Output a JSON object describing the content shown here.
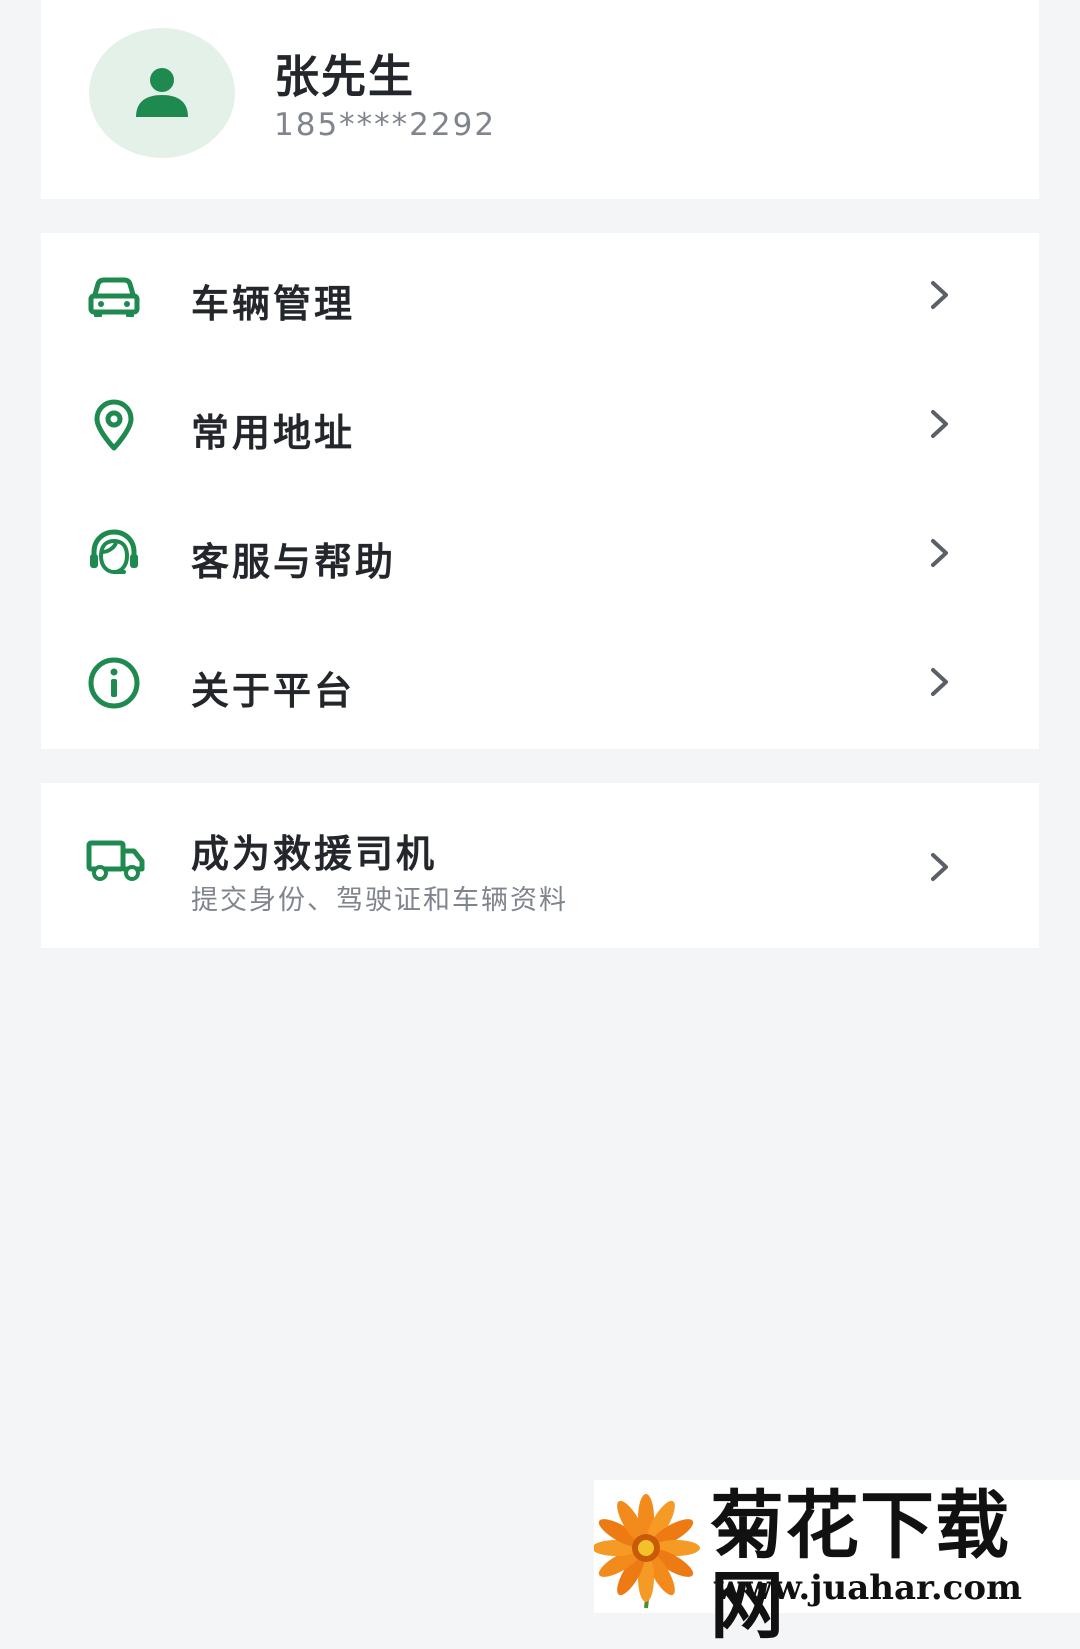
{
  "profile": {
    "name": "张先生",
    "phone": "185****2292",
    "avatar_icon": "user-avatar-icon"
  },
  "menu": {
    "items": [
      {
        "label": "车辆管理",
        "icon": "car-icon"
      },
      {
        "label": "常用地址",
        "icon": "location-pin-icon"
      },
      {
        "label": "客服与帮助",
        "icon": "customer-service-icon"
      },
      {
        "label": "关于平台",
        "icon": "info-icon"
      }
    ]
  },
  "driver": {
    "title": "成为救援司机",
    "subtitle": "提交身份、驾驶证和车辆资料",
    "icon": "truck-icon"
  },
  "watermark": {
    "brand": "菊花下载网",
    "url": "www.juahar.com"
  },
  "colors": {
    "accent": "#1e8a4f",
    "avatar_bg": "#e3f1e8",
    "background": "#f4f5f7",
    "text_primary": "#23262b",
    "text_secondary": "#80858d",
    "chevron": "#5b6068"
  }
}
